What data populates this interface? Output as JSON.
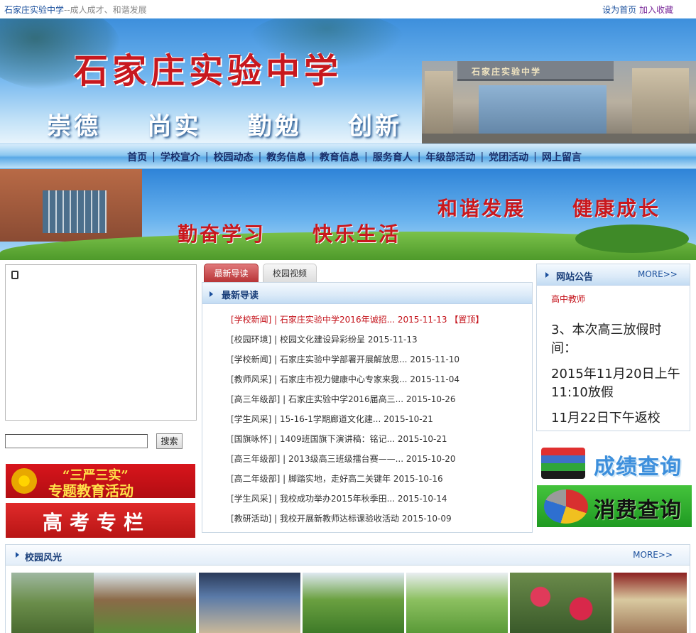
{
  "topbar": {
    "site_name": "石家庄实验中学",
    "slogan": "--成人成才、和谐发展",
    "set_home": "设为首页",
    "add_favorite": "加入收藏"
  },
  "header": {
    "school_name": "石家庄实验中学",
    "gate_sign": "石家庄实验中学",
    "motto": [
      "崇德",
      "尚实",
      "勤勉",
      "创新"
    ]
  },
  "nav": {
    "items": [
      "首页",
      "学校宣介",
      "校园动态",
      "教务信息",
      "教育信息",
      "服务育人",
      "年级部活动",
      "党团活动",
      "网上留言"
    ]
  },
  "banner2": {
    "line1a": "和谐发展",
    "line1b": "健康成长",
    "line2a": "勤奋学习",
    "line2b": "快乐生活"
  },
  "search": {
    "value": "",
    "button_label": "搜索"
  },
  "promos": {
    "sanyan_line1": "“三严三实”",
    "sanyan_line2": "专题教育活动",
    "gaokao": "高考专栏"
  },
  "news": {
    "tabs": [
      "最新导读",
      "校园视频"
    ],
    "panel_title": "最新导读",
    "items": [
      {
        "text": "[学校新闻] | 石家庄实验中学2016年诚招... 2015-11-13 【置顶】",
        "hot": true
      },
      {
        "text": "[校园环境] | 校园文化建设异彩纷呈  2015-11-13",
        "hot": false
      },
      {
        "text": "[学校新闻] | 石家庄实验中学部署开展解放思... 2015-11-10",
        "hot": false
      },
      {
        "text": "[教师风采] | 石家庄市视力健康中心专家来我... 2015-11-04",
        "hot": false
      },
      {
        "text": "[高三年级部] | 石家庄实验中学2016届高三... 2015-10-26",
        "hot": false
      },
      {
        "text": "[学生风采] | 15-16-1学期廊道文化建... 2015-10-21",
        "hot": false
      },
      {
        "text": "[国旗咏怀] | 1409班国旗下演讲稿：铭记... 2015-10-21",
        "hot": false
      },
      {
        "text": "[高三年级部] | 2013级高三班级擂台赛——... 2015-10-20",
        "hot": false
      },
      {
        "text": "[高二年级部] | 脚踏实地，走好高二关键年  2015-10-16",
        "hot": false
      },
      {
        "text": "[学生风采] | 我校成功举办2015年秋季田... 2015-10-14",
        "hot": false
      },
      {
        "text": "[教研活动] | 我校开展新教师达标课验收活动  2015-10-09",
        "hot": false
      }
    ]
  },
  "notice": {
    "title": "网站公告",
    "more": "MORE>>",
    "subtitle": "高中教师",
    "lines": [
      "3、本次高三放假时间：",
      "2015年11月20日上午11:10放假",
      "11月22日下午返校"
    ]
  },
  "queries": {
    "grades": "成绩查询",
    "consumption": "消费查询"
  },
  "gallery": {
    "title": "校园风光",
    "more": "MORE>>"
  },
  "colors": {
    "nav_text": "#1a2f6b",
    "accent_red": "#c8181e",
    "link_blue": "#1a4f9c"
  }
}
